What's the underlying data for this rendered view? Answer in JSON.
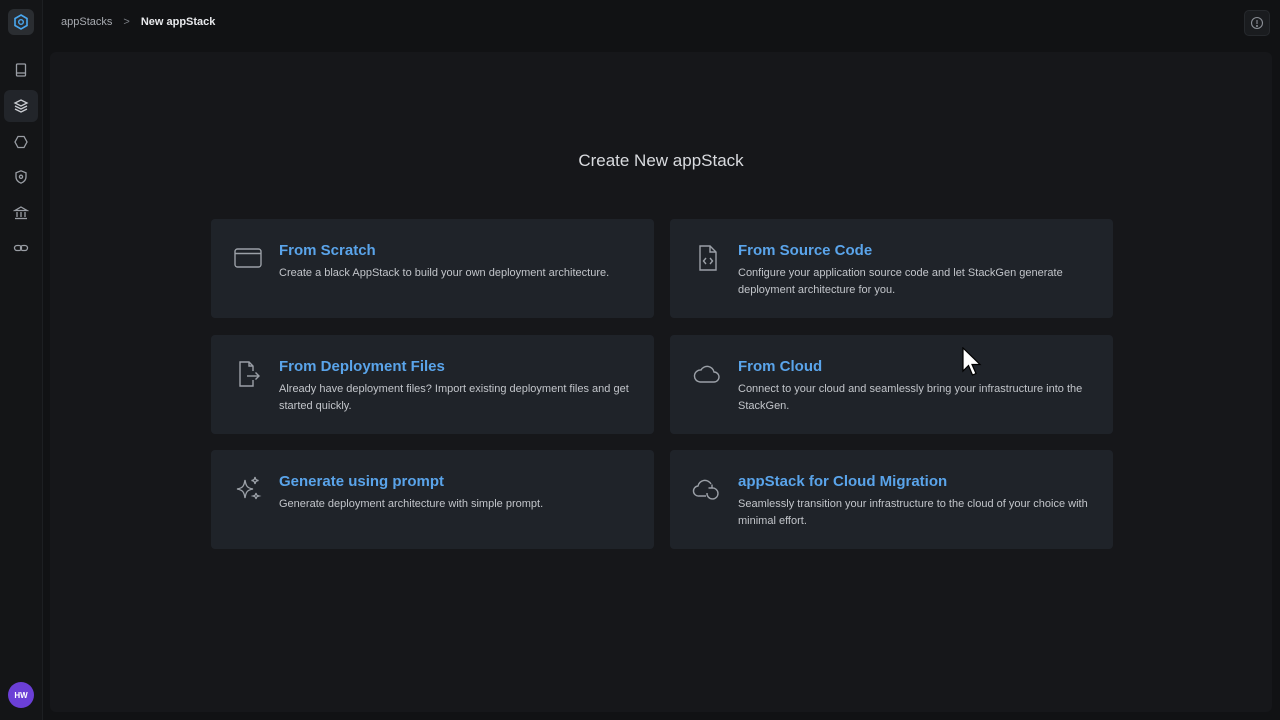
{
  "breadcrumb": {
    "parent": "appStacks",
    "separator": ">",
    "current": "New appStack"
  },
  "sidebar": {
    "avatar_initials": "HW",
    "items": [
      {
        "icon": "book-icon"
      },
      {
        "icon": "layers-icon",
        "active": true
      },
      {
        "icon": "hexagon-icon"
      },
      {
        "icon": "shield-icon"
      },
      {
        "icon": "bank-icon"
      },
      {
        "icon": "link-icon"
      }
    ]
  },
  "page": {
    "title": "Create New appStack"
  },
  "cards": [
    {
      "title": "From Scratch",
      "description": "Create a black AppStack to build your own deployment architecture.",
      "icon": "window-icon"
    },
    {
      "title": "From Source Code",
      "description": "Configure your application source code and let StackGen generate deployment architecture for you.",
      "icon": "file-code-icon"
    },
    {
      "title": "From Deployment Files",
      "description": "Already have deployment files? Import existing deployment files and get started quickly.",
      "icon": "file-export-icon"
    },
    {
      "title": "From Cloud",
      "description": "Connect to your cloud and seamlessly bring your infrastructure into the StackGen.",
      "icon": "cloud-icon"
    },
    {
      "title": "Generate using prompt",
      "description": "Generate deployment architecture with simple prompt.",
      "icon": "sparkles-icon"
    },
    {
      "title": "appStack for Cloud Migration",
      "description": "Seamlessly transition your infrastructure to the cloud of your choice with minimal effort.",
      "icon": "cloud-migration-icon"
    }
  ],
  "colors": {
    "accent": "#5aa4ea",
    "card_bg": "#1f2329",
    "page_bg": "#111214",
    "avatar": "#6b3fd6"
  }
}
